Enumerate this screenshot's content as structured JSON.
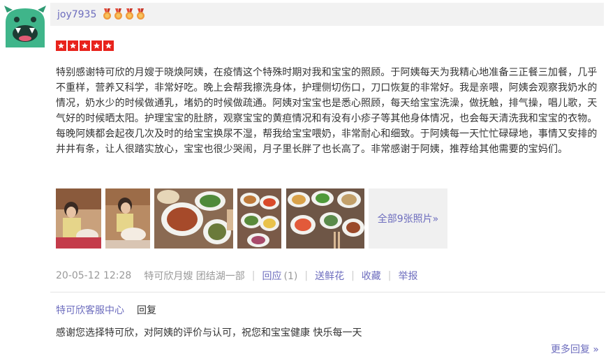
{
  "review": {
    "username": "joy7935",
    "medal_count": 4,
    "rating": 5,
    "text": "特别感谢特可欣的月嫂于晓焕阿姨，在疫情这个特殊时期对我和宝宝的照顾。于阿姨每天为我精心地准备三正餐三加餐，几乎不重样，营养又科学，非常好吃。晚上会帮我擦洗身体，护理侧切伤口，刀口恢复的非常好。我是亲喂，阿姨会观察我奶水的情况，奶水少的时候做通乳，堵奶的时候做疏通。阿姨对宝宝也是悉心照顾，每天给宝宝洗澡，做抚触，排气操，唱儿歌，天气好的时候晒太阳。护理宝宝的肚脐，观察宝宝的黄疸情况和有没有小疹子等其他身体情况，也会每天清洗我和宝宝的衣物。每晚阿姨都会起夜几次及时的给宝宝换尿不湿，帮我给宝宝喂奶，非常耐心和细致。于阿姨每一天忙忙碌碌地，事情又安排的井井有条，让人很踏实放心，宝宝也很少哭闹，月子里长胖了也长高了。非常感谢于阿姨，推荐给其他需要的宝妈们。",
    "photos_more_label": "全部9张照片»",
    "date": "20-05-12 12:28",
    "service": "特可欣月嫂 团结湖一部",
    "reply_label": "回应",
    "reply_count": "(1)",
    "flower_label": "送鲜花",
    "favorite_label": "收藏",
    "report_label": "举报"
  },
  "reply": {
    "from": "特可欣客服中心",
    "word": "回复",
    "text": "感谢您选择特可欣，对阿姨的评价与认可，祝您和宝宝健康 快乐每一天",
    "more_label": "更多回复 »"
  },
  "colors": {
    "link": "#6d6dbe",
    "star_red": "#e8231c",
    "avatar_green": "#3fb58a",
    "medal_orange": "#f09a3e"
  }
}
